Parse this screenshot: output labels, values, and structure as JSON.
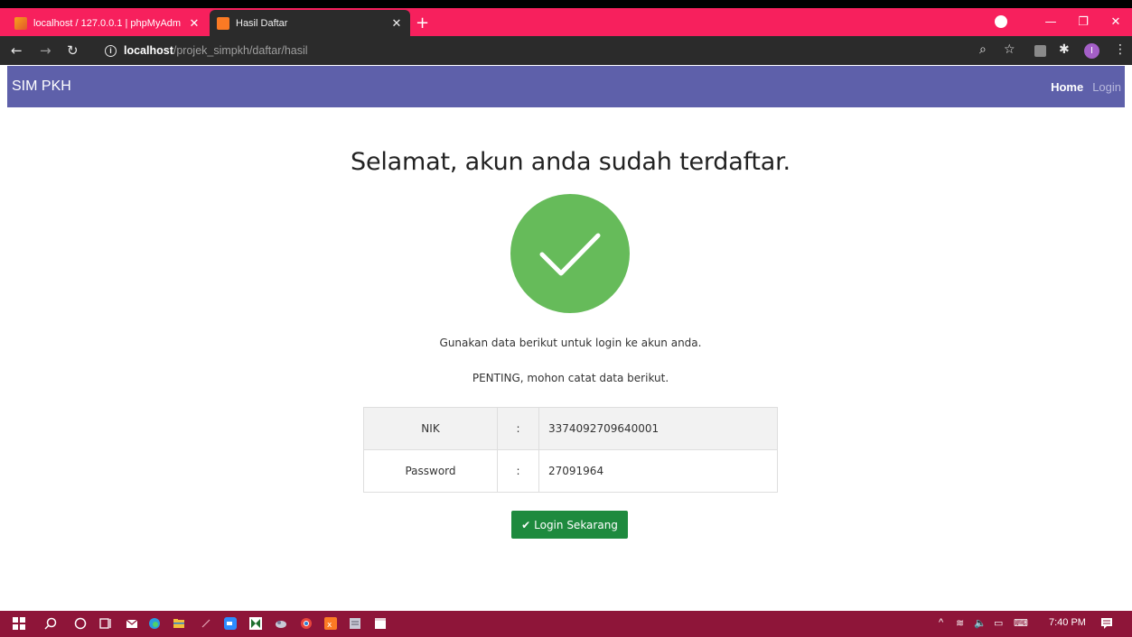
{
  "browser": {
    "tabs": [
      {
        "title": "localhost / 127.0.0.1 | phpMyAdm",
        "active": false
      },
      {
        "title": "Hasil Daftar",
        "active": true
      }
    ],
    "new_tab_label": "+",
    "url_host": "localhost",
    "url_path": "/projek_simpkh/daftar/hasil",
    "profile_initial": "I"
  },
  "navbar": {
    "brand": "SIM PKH",
    "links": {
      "home": "Home",
      "login": "Login"
    }
  },
  "main": {
    "title": "Selamat, akun anda sudah terdaftar.",
    "message1": "Gunakan data berikut untuk login ke akun anda.",
    "message2": "PENTING, mohon catat data berikut.",
    "credentials": [
      {
        "label": "NIK",
        "separator": ":",
        "value": "3374092709640001"
      },
      {
        "label": "Password",
        "separator": ":",
        "value": "27091964"
      }
    ],
    "login_button": "Login Sekarang",
    "success_color": "#66bb5a",
    "button_color": "#1e8a3e"
  },
  "taskbar": {
    "time": "7:40 PM",
    "color": "#8e1539"
  },
  "colors": {
    "tab_bar": "#f7205d",
    "navbar": "#5e60aa"
  }
}
